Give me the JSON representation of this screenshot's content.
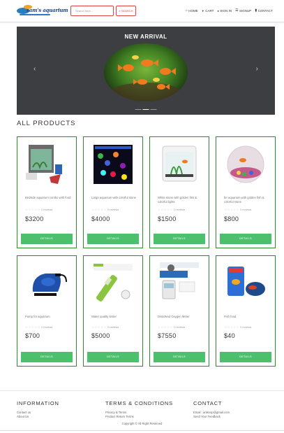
{
  "header": {
    "logo_text": "sam's aquarium",
    "search_placeholder": "Search here...",
    "search_button": "SEARCH",
    "nav": [
      {
        "icon": "home-icon",
        "glyph": "⌂",
        "label": "HOME"
      },
      {
        "icon": "cart-icon",
        "glyph": "🛒",
        "label": "CART"
      },
      {
        "icon": "user-icon",
        "glyph": "👤",
        "label": "SIGN IN"
      },
      {
        "icon": "signup-icon",
        "glyph": "☰",
        "label": "SIGNUP"
      },
      {
        "icon": "contact-icon",
        "glyph": "▮",
        "label": "CONTACT"
      }
    ]
  },
  "carousel": {
    "title": "NEW ARRIVAL",
    "prev": "‹",
    "next": "›",
    "indicators": 3,
    "active_index": 1
  },
  "section_title": "ALL PRODUCTS",
  "products": [
    {
      "name": "Bedside aquarium combo with food",
      "rating": 0,
      "reviews": "0 reviews",
      "price": "$3200",
      "button": "DETAILS",
      "icon": "aquarium-combo-image"
    },
    {
      "name": "Large aquarium with colorful stone",
      "rating": 0,
      "reviews": "0 reviews",
      "price": "$4000",
      "button": "DETAILS",
      "icon": "colorful-stone-image"
    },
    {
      "name": "White stone with golden fish & colorful lights",
      "rating": 0,
      "reviews": "0 reviews",
      "price": "$1500",
      "button": "DETAILS",
      "icon": "white-tank-image"
    },
    {
      "name": "fer aquarium with golden fish & colorful stone",
      "rating": 0,
      "reviews": "0 reviews",
      "price": "$800",
      "button": "DETAILS",
      "icon": "fishbowl-image"
    },
    {
      "name": "Pump for aquarium",
      "rating": 0,
      "reviews": "0 reviews",
      "price": "$700",
      "button": "DETAILS",
      "icon": "air-pump-image"
    },
    {
      "name": "Water quality tester",
      "rating": 0,
      "reviews": "0 reviews",
      "price": "$5000",
      "button": "DETAILS",
      "icon": "water-tester-image"
    },
    {
      "name": "Dissolved Oxygen Meter",
      "rating": 0,
      "reviews": "0 reviews",
      "price": "$7550",
      "button": "DETAILS",
      "icon": "oxygen-meter-image"
    },
    {
      "name": "Fish food",
      "rating": 0,
      "reviews": "0 reviews",
      "price": "$40",
      "button": "DETAILS",
      "icon": "fish-food-image"
    }
  ],
  "footer": {
    "info_title": "INFORMATION",
    "info_links": [
      "Contact us",
      "About Us"
    ],
    "terms_title": "TERMS & CONDITIONS",
    "terms_links": [
      "Privacy & Terms",
      "Product Return Terms"
    ],
    "contact_title": "CONTACT",
    "contact_lines": [
      "Email : anikeop@gmail.com",
      "Send Your Feedback"
    ],
    "copyright": "Copyright © All Right Reserved"
  },
  "colors": {
    "accent_green": "#4cc06d",
    "card_border": "#2d8a2d",
    "search_red": "#dd4444",
    "carousel_bg": "#3c3e42"
  }
}
